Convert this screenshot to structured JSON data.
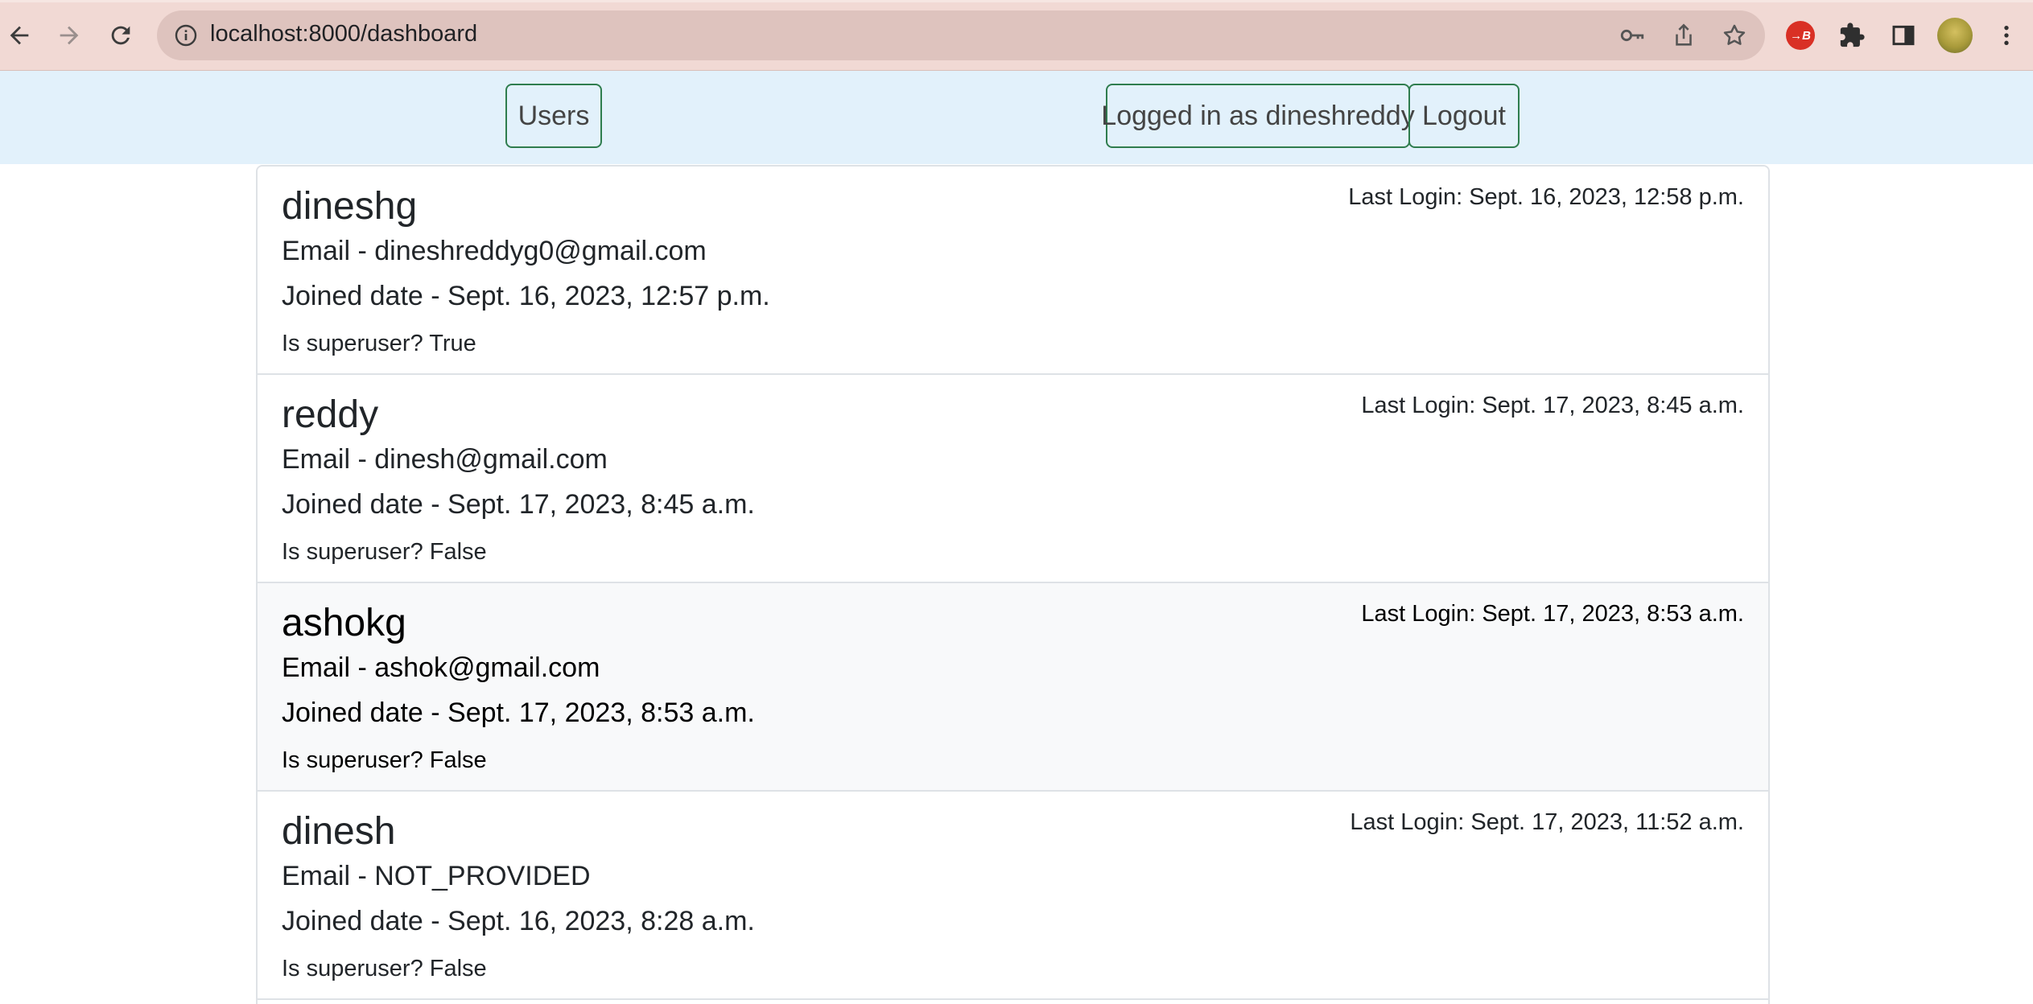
{
  "browser": {
    "url": "localhost:8000/dashboard",
    "badge_text": "→B"
  },
  "navbar": {
    "users_label": "Users",
    "logged_in_label": "Logged in as dineshreddy",
    "logout_label": "Logout"
  },
  "users": [
    {
      "username": "dineshg",
      "last_login": "Last Login: Sept. 16, 2023, 12:58 p.m.",
      "email": "Email - dineshreddyg0@gmail.com",
      "joined": "Joined date - Sept. 16, 2023, 12:57 p.m.",
      "superuser": "Is superuser? True"
    },
    {
      "username": "reddy",
      "last_login": "Last Login: Sept. 17, 2023, 8:45 a.m.",
      "email": "Email - dinesh@gmail.com",
      "joined": "Joined date - Sept. 17, 2023, 8:45 a.m.",
      "superuser": "Is superuser? False"
    },
    {
      "username": "ashokg",
      "last_login": "Last Login: Sept. 17, 2023, 8:53 a.m.",
      "email": "Email - ashok@gmail.com",
      "joined": "Joined date - Sept. 17, 2023, 8:53 a.m.",
      "superuser": "Is superuser? False"
    },
    {
      "username": "dinesh",
      "last_login": "Last Login: Sept. 17, 2023, 11:52 a.m.",
      "email": "Email - NOT_PROVIDED",
      "joined": "Joined date - Sept. 16, 2023, 8:28 a.m.",
      "superuser": "Is superuser? False"
    }
  ],
  "colors": {
    "chrome_bg": "#f1d9d4",
    "navbar_bg": "#e2f1fb",
    "button_border": "#2f7d4e",
    "active_row_bg": "#f8f9fa"
  }
}
